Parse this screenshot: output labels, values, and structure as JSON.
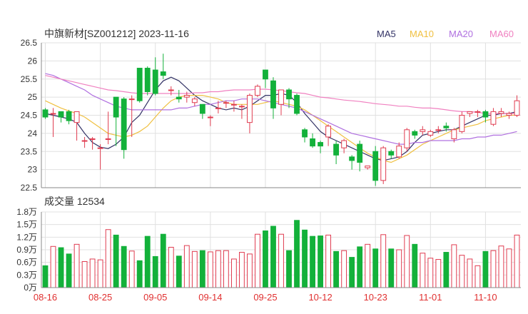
{
  "title": "中旗新材[SZ001212] 2023-11-16",
  "volume_title": "成交量 12534",
  "legend": [
    {
      "name": "MA5",
      "color": "#333366"
    },
    {
      "name": "MA10",
      "color": "#f0c040"
    },
    {
      "name": "MA20",
      "color": "#b070e0"
    },
    {
      "name": "MA60",
      "color": "#f080c0"
    }
  ],
  "colors": {
    "up": "#e03c50",
    "down": "#13b13a",
    "grid": "#e0e0e0",
    "axis": "#888888",
    "date_label": "#e03030"
  },
  "chart_data": [
    {
      "type": "candlestick",
      "title": "中旗新材[SZ001212] 2023-11-16",
      "ylim": [
        22.5,
        26.5
      ],
      "yticks": [
        22.5,
        23,
        23.5,
        24,
        24.5,
        25,
        25.5,
        26,
        26.5
      ],
      "ytick_labels": [
        "22.5",
        "23",
        "23.5",
        "24",
        "24.5",
        "25",
        "25.5",
        "26",
        "26.5"
      ],
      "dates": [
        "08-16",
        "08-17",
        "08-18",
        "08-21",
        "08-22",
        "08-23",
        "08-24",
        "08-25",
        "08-28",
        "08-29",
        "08-30",
        "08-31",
        "09-01",
        "09-04",
        "09-05",
        "09-06",
        "09-07",
        "09-08",
        "09-11",
        "09-12",
        "09-13",
        "09-14",
        "09-15",
        "09-18",
        "09-19",
        "09-20",
        "09-21",
        "09-22",
        "09-25",
        "09-26",
        "09-27",
        "09-28",
        "10-09",
        "10-10",
        "10-11",
        "10-12",
        "10-13",
        "10-16",
        "10-17",
        "10-18",
        "10-19",
        "10-20",
        "10-23",
        "10-24",
        "10-25",
        "10-26",
        "10-27",
        "10-30",
        "10-31",
        "11-01",
        "11-02",
        "11-03",
        "11-06",
        "11-07",
        "11-08",
        "11-09",
        "11-10",
        "11-13",
        "11-14",
        "11-15",
        "11-16"
      ],
      "x_tick_labels": [
        "08-16",
        "08-25",
        "09-05",
        "09-14",
        "09-25",
        "10-12",
        "10-23",
        "11-01",
        "11-10"
      ],
      "x_tick_indices": [
        0,
        7,
        14,
        21,
        28,
        35,
        42,
        49,
        56
      ],
      "open": [
        24.65,
        24.55,
        24.6,
        24.6,
        24.3,
        23.8,
        23.85,
        23.6,
        23.85,
        25.0,
        24.95,
        24.95,
        25.8,
        25.8,
        25.75,
        25.7,
        25.2,
        25.0,
        25.0,
        24.85,
        24.8,
        24.45,
        24.7,
        24.85,
        24.8,
        24.75,
        24.3,
        25.05,
        25.75,
        25.45,
        24.8,
        25.2,
        25.05,
        24.1,
        23.85,
        23.75,
        23.9,
        23.7,
        23.6,
        23.35,
        23.7,
        23.05,
        23.5,
        22.7,
        23.5,
        23.35,
        23.6,
        24.05,
        24.05,
        23.95,
        24.1,
        24.2,
        23.85,
        24.05,
        24.55,
        24.6,
        24.6,
        24.25,
        24.55,
        24.5,
        24.5
      ],
      "close": [
        24.45,
        24.55,
        24.45,
        24.35,
        24.6,
        23.8,
        23.85,
        23.6,
        23.85,
        24.45,
        23.55,
        24.95,
        24.9,
        25.15,
        25.1,
        25.6,
        25.2,
        24.95,
        25.05,
        24.95,
        24.55,
        24.45,
        24.7,
        24.85,
        24.8,
        24.75,
        25.05,
        25.3,
        25.5,
        24.7,
        25.2,
        24.95,
        24.55,
        23.9,
        23.65,
        23.65,
        24.2,
        23.4,
        23.8,
        23.25,
        23.2,
        23.1,
        22.7,
        23.6,
        23.4,
        23.65,
        24.1,
        23.95,
        24.1,
        24.05,
        24.1,
        24.15,
        24.1,
        24.5,
        24.6,
        24.6,
        24.45,
        24.6,
        24.6,
        24.55,
        24.9
      ],
      "high": [
        24.7,
        24.7,
        24.6,
        24.65,
        24.6,
        23.9,
        23.9,
        23.7,
        24.6,
        25.0,
        25.0,
        25.05,
        25.8,
        25.85,
        26.1,
        26.2,
        25.3,
        25.2,
        25.15,
        25.0,
        24.8,
        24.5,
        24.9,
        24.9,
        24.9,
        24.8,
        25.1,
        25.35,
        25.7,
        25.55,
        25.2,
        25.25,
        25.1,
        24.15,
        24.0,
        23.8,
        24.25,
        23.8,
        23.85,
        23.4,
        23.8,
        23.1,
        23.65,
        23.65,
        23.55,
        23.75,
        24.15,
        24.1,
        24.2,
        24.1,
        24.2,
        24.3,
        24.15,
        24.6,
        24.6,
        24.65,
        24.65,
        24.7,
        24.7,
        24.6,
        25.05
      ],
      "low": [
        24.4,
        23.9,
        24.3,
        24.25,
        23.8,
        23.6,
        23.55,
        23.0,
        23.7,
        23.65,
        23.3,
        23.9,
        24.85,
        25.05,
        25.05,
        25.5,
        25.05,
        24.85,
        24.85,
        24.75,
        24.4,
        24.2,
        24.55,
        24.7,
        24.6,
        24.4,
        24.0,
        25.0,
        25.25,
        24.4,
        24.5,
        24.7,
        24.5,
        23.75,
        23.6,
        23.45,
        23.65,
        23.15,
        23.45,
        23.0,
        22.95,
        23.0,
        22.55,
        22.6,
        23.3,
        23.3,
        23.5,
        23.85,
        23.95,
        23.9,
        24.0,
        24.05,
        23.75,
        24.0,
        24.45,
        24.45,
        24.3,
        24.2,
        24.45,
        24.4,
        24.45
      ],
      "ma": {
        "MA5": [
          24.55,
          24.5,
          24.45,
          24.4,
          24.3,
          24.0,
          23.75,
          23.62,
          23.58,
          23.7,
          23.9,
          24.3,
          24.5,
          24.85,
          25.2,
          25.45,
          25.55,
          25.45,
          25.25,
          25.05,
          24.9,
          24.8,
          24.7,
          24.65,
          24.7,
          24.65,
          24.75,
          24.9,
          25.05,
          25.05,
          25.1,
          25.05,
          24.85,
          24.55,
          24.3,
          24.05,
          23.9,
          23.8,
          23.7,
          23.6,
          23.5,
          23.4,
          23.3,
          23.25,
          23.3,
          23.35,
          23.5,
          23.75,
          23.95,
          24.0,
          24.05,
          24.1,
          24.1,
          24.2,
          24.3,
          24.4,
          24.5,
          24.5,
          24.55,
          24.55,
          24.6
        ],
        "MA10": [
          24.9,
          24.8,
          24.7,
          24.62,
          24.55,
          24.45,
          24.3,
          24.15,
          24.0,
          23.95,
          23.9,
          23.95,
          24.05,
          24.2,
          24.45,
          24.7,
          24.9,
          25.0,
          25.05,
          25.05,
          25.05,
          25.0,
          24.95,
          24.85,
          24.8,
          24.8,
          24.8,
          24.8,
          24.85,
          24.9,
          24.85,
          24.8,
          24.75,
          24.65,
          24.5,
          24.35,
          24.2,
          24.05,
          23.9,
          23.75,
          23.6,
          23.45,
          23.35,
          23.25,
          23.2,
          23.3,
          23.4,
          23.55,
          23.7,
          23.8,
          23.9,
          24.0,
          24.1,
          24.15,
          24.2,
          24.25,
          24.35,
          24.4,
          24.45,
          24.5,
          24.5
        ],
        "MA20": [
          25.65,
          25.6,
          25.5,
          25.4,
          25.3,
          25.2,
          25.05,
          24.95,
          24.85,
          24.75,
          24.7,
          24.65,
          24.65,
          24.65,
          24.65,
          24.65,
          24.65,
          24.7,
          24.7,
          24.75,
          24.8,
          24.8,
          24.85,
          24.9,
          24.9,
          24.95,
          24.95,
          24.95,
          24.9,
          24.85,
          24.8,
          24.75,
          24.7,
          24.6,
          24.5,
          24.4,
          24.3,
          24.2,
          24.1,
          24.0,
          23.95,
          23.9,
          23.85,
          23.8,
          23.75,
          23.7,
          23.7,
          23.75,
          23.75,
          23.8,
          23.8,
          23.8,
          23.8,
          23.85,
          23.85,
          23.9,
          23.9,
          23.95,
          23.95,
          24.0,
          24.05
        ],
        "MA60": [
          25.6,
          25.55,
          25.5,
          25.45,
          25.4,
          25.35,
          25.3,
          25.25,
          25.2,
          25.18,
          25.15,
          25.12,
          25.1,
          25.1,
          25.1,
          25.1,
          25.1,
          25.1,
          25.1,
          25.12,
          25.12,
          25.15,
          25.15,
          25.18,
          25.2,
          25.2,
          25.2,
          25.22,
          25.22,
          25.2,
          25.18,
          25.15,
          25.12,
          25.1,
          25.05,
          25.0,
          24.98,
          24.95,
          24.92,
          24.9,
          24.88,
          24.85,
          24.82,
          24.8,
          24.78,
          24.75,
          24.75,
          24.72,
          24.7,
          24.7,
          24.68,
          24.65,
          24.62,
          24.6,
          24.6,
          24.58,
          24.55,
          24.55,
          24.55,
          24.55,
          24.55
        ]
      }
    },
    {
      "type": "bar",
      "title": "成交量 12534",
      "ylim": [
        0,
        18000
      ],
      "yticks": [
        0,
        3000,
        6000,
        9000,
        12000,
        15000,
        18000
      ],
      "ytick_labels": [
        "0万",
        "0.3万",
        "0.6万",
        "0.9万",
        "1.2万",
        "1.5万",
        "1.8万"
      ],
      "volume": [
        5200,
        9800,
        9500,
        8000,
        10300,
        6200,
        6800,
        6600,
        13800,
        12500,
        9800,
        8700,
        6400,
        12200,
        7400,
        12700,
        9600,
        7500,
        10000,
        8600,
        8800,
        8500,
        8800,
        8800,
        6800,
        8400,
        8000,
        12700,
        13500,
        14600,
        12700,
        8800,
        16000,
        13700,
        12200,
        12300,
        12500,
        8600,
        8800,
        7200,
        9700,
        10300,
        9200,
        12600,
        9200,
        9000,
        12400,
        10300,
        8200,
        7000,
        6700,
        8400,
        10200,
        7700,
        6800,
        5200,
        8600,
        8800,
        9900,
        9200,
        12500
      ]
    }
  ]
}
